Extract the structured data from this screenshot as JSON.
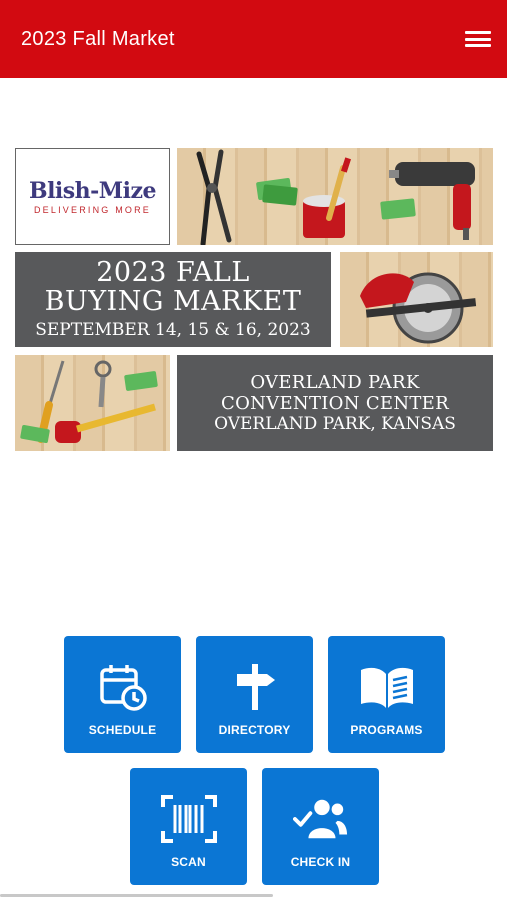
{
  "header": {
    "title": "2023 Fall Market",
    "menu_icon": "hamburger-menu-icon",
    "background": "#d20a11"
  },
  "banner": {
    "logo_name": "Blish-Mize",
    "logo_tagline": "DELIVERING MORE",
    "event_title_line1": "2023 FALL",
    "event_title_line2": "BUYING MARKET",
    "event_dates": "SEPTEMBER 14, 15 & 16, 2023",
    "venue_line1": "OVERLAND PARK",
    "venue_line2": "CONVENTION CENTER",
    "venue_location": "OVERLAND PARK, KANSAS"
  },
  "actions": [
    {
      "label": "SCHEDULE",
      "icon": "calendar-clock-icon"
    },
    {
      "label": "DIRECTORY",
      "icon": "signpost-icon"
    },
    {
      "label": "PROGRAMS",
      "icon": "open-book-icon"
    },
    {
      "label": "SCAN",
      "icon": "barcode-scan-icon"
    },
    {
      "label": "CHECK IN",
      "icon": "people-check-icon"
    }
  ],
  "colors": {
    "accent": "#0b76d4",
    "panel_gray": "#58595b",
    "brand_blue": "#3e3a7e",
    "brand_red": "#c1272d"
  }
}
